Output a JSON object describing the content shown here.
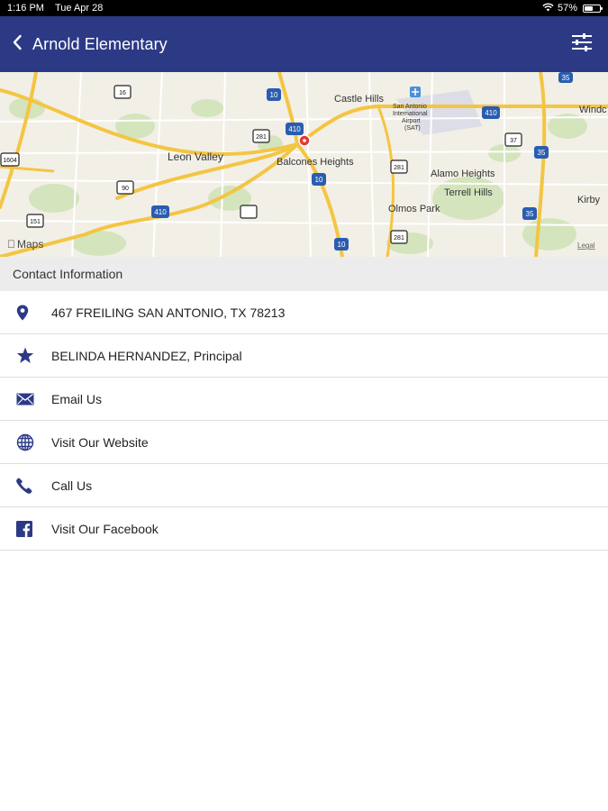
{
  "status_bar": {
    "time": "1:16 PM",
    "date": "Tue Apr 28",
    "battery": "57%",
    "battery_level": 0.57
  },
  "header": {
    "title": "Arnold Elementary",
    "back_icon": "chevron-left-icon",
    "filter_icon": "sliders-icon"
  },
  "map": {
    "attribution": "Maps",
    "legal": "Legal",
    "places": [
      "Castle Hills",
      "Leon Valley",
      "Balcones Heights",
      "Alamo Heights",
      "Terrell Hills",
      "Olmos Park",
      "Windc",
      "Kirby"
    ],
    "airport": [
      "San Antonio",
      "International",
      "Airport",
      "(SAT)"
    ],
    "highway_shields": [
      "410",
      "10",
      "35",
      "16",
      "281",
      "1604",
      "151",
      "90",
      "37"
    ]
  },
  "section": {
    "title": "Contact Information"
  },
  "contacts": [
    {
      "icon": "map-pin-icon",
      "label": "467 FREILING SAN ANTONIO, TX 78213"
    },
    {
      "icon": "star-icon",
      "label": "BELINDA HERNANDEZ, Principal"
    },
    {
      "icon": "envelope-icon",
      "label": "Email Us"
    },
    {
      "icon": "globe-icon",
      "label": "Visit Our Website"
    },
    {
      "icon": "phone-icon",
      "label": "Call Us"
    },
    {
      "icon": "facebook-icon",
      "label": "Visit Our Facebook"
    }
  ],
  "colors": {
    "header_bg": "#2c3a86",
    "icon_color": "#2c3a86",
    "section_bg": "#ececec",
    "map_pin": "#e53935"
  }
}
